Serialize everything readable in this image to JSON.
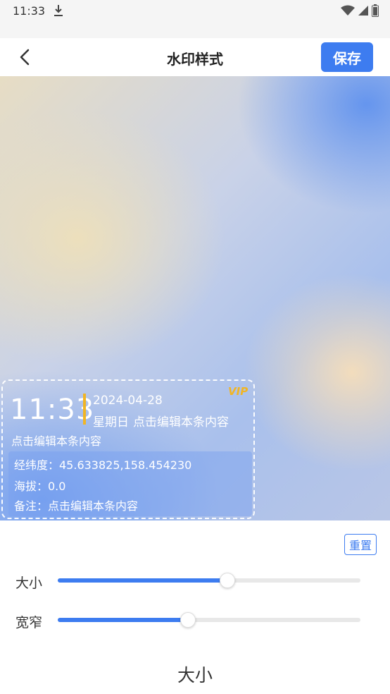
{
  "status_bar": {
    "time": "11:33"
  },
  "app_bar": {
    "title": "水印样式",
    "save_label": "保存"
  },
  "watermark": {
    "vip": "VIP",
    "time": "11:33",
    "date": "2024-04-28",
    "weekday": "星期日",
    "weekday_note": "点击编辑本条内容",
    "title": "点击编辑本条内容",
    "coords": "经纬度：45.633825,158.454230",
    "altitude": "海拔：0.0",
    "remark": "备注：点击编辑本条内容"
  },
  "controls": {
    "reset_label": "重置",
    "sliders": [
      {
        "label": "大小",
        "value": 0.56
      },
      {
        "label": "宽窄",
        "value": 0.43
      }
    ]
  },
  "bottom_label": "大小"
}
